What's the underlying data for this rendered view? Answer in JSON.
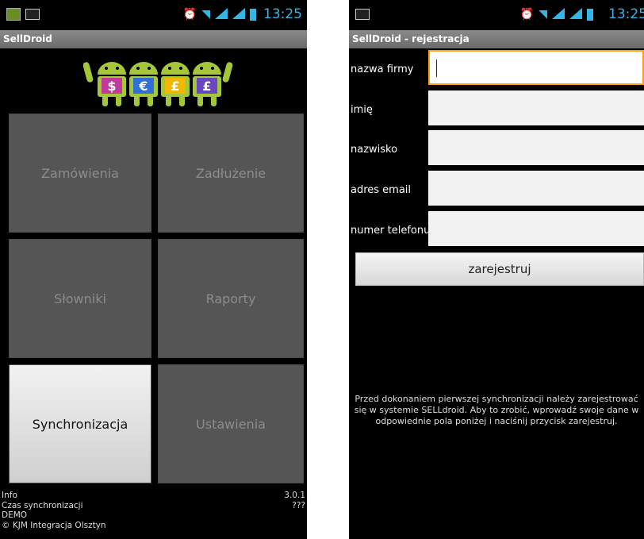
{
  "left": {
    "status": {
      "time": "13:25"
    },
    "title": "SellDroid",
    "tiles": [
      {
        "label": "Zamówienia"
      },
      {
        "label": "Zadłużenie"
      },
      {
        "label": "Słowniki"
      },
      {
        "label": "Raporty"
      },
      {
        "label": "Synchronizacja"
      },
      {
        "label": "Ustawienia"
      }
    ],
    "info": {
      "info_label": "Info",
      "version": "3.0.1",
      "sync_label": "Czas synchronizacji",
      "sync_value": "???",
      "mode": "DEMO",
      "copyright": "© KJM Integracja Olsztyn"
    },
    "logo_currencies": [
      "$",
      "€",
      "£",
      "£"
    ],
    "colors": {
      "tile": "#555555",
      "tile_active": "#e6e6e6",
      "accent": "#33b5e5"
    }
  },
  "right": {
    "status": {
      "time": "13:25"
    },
    "title": "SellDroid - rejestracja",
    "fields": [
      {
        "label": "nazwa firmy",
        "value": ""
      },
      {
        "label": "imię",
        "value": ""
      },
      {
        "label": "nazwisko",
        "value": ""
      },
      {
        "label": "adres email",
        "value": ""
      },
      {
        "label": "numer telefonu",
        "value": ""
      }
    ],
    "register_button": "zarejestruj",
    "info_text": "Przed dokonaniem pierwszej synchronizacji należy zarejestrować się w systemie SELLdroid. Aby to zrobić, wprowadź swoje dane w odpowiednie pola poniżej i naciśnij przycisk zarejestruj.",
    "colors": {
      "focus_border": "#ff9f1a"
    }
  }
}
